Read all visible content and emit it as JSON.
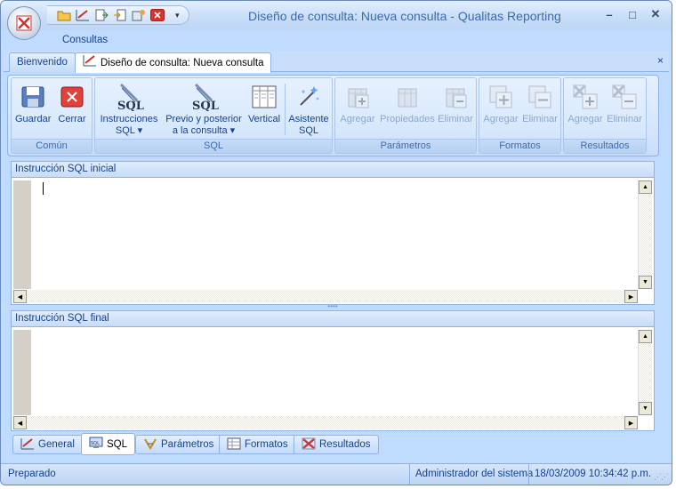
{
  "window": {
    "title": "Diseño de consulta: Nueva consulta",
    "title_sep": " - ",
    "app_name": "Qualitas Reporting",
    "minimize_label": "–",
    "maximize_label": "□",
    "close_label": "✕"
  },
  "quick_access": {
    "dropdown_label": "▾"
  },
  "menu": {
    "tab_label": "Consultas"
  },
  "doc_tabs": [
    {
      "label": "Bienvenido"
    },
    {
      "label": "Diseño de consulta: Nueva consulta"
    }
  ],
  "doc_close": "×",
  "ribbon": {
    "groups": {
      "common": "Común",
      "sql": "SQL",
      "params": "Parámetros",
      "formats": "Formatos",
      "results": "Resultados"
    },
    "buttons": {
      "save": "Guardar",
      "close": "Cerrar",
      "instr_1": "Instrucciones",
      "instr_2": "SQL ▾",
      "prevpost_1": "Previo y posterior",
      "prevpost_2": "a la consulta ▾",
      "vertical": "Vertical",
      "wizard_1": "Asistente",
      "wizard_2": "SQL",
      "param_add": "Agregar",
      "param_props": "Propiedades",
      "param_del": "Eliminar",
      "fmt_add": "Agregar",
      "fmt_del": "Eliminar",
      "res_add": "Agregar",
      "res_del": "Eliminar"
    },
    "sql_icon_text": "SQL"
  },
  "panels": {
    "initial": {
      "header": "Instrucción SQL inicial"
    },
    "final": {
      "header": "Instrucción SQL final"
    }
  },
  "bottom_tabs": [
    {
      "label": "General"
    },
    {
      "label": "SQL"
    },
    {
      "label": "Parámetros"
    },
    {
      "label": "Formatos"
    },
    {
      "label": "Resultados"
    }
  ],
  "status": {
    "state": "Preparado",
    "user": "Administrador del sistema",
    "datetime": "18/03/2009 10:34:42 p.m."
  },
  "colors": {
    "accent": "#15428b",
    "frame": "#bfdbff",
    "close_red": "#d9312b"
  }
}
